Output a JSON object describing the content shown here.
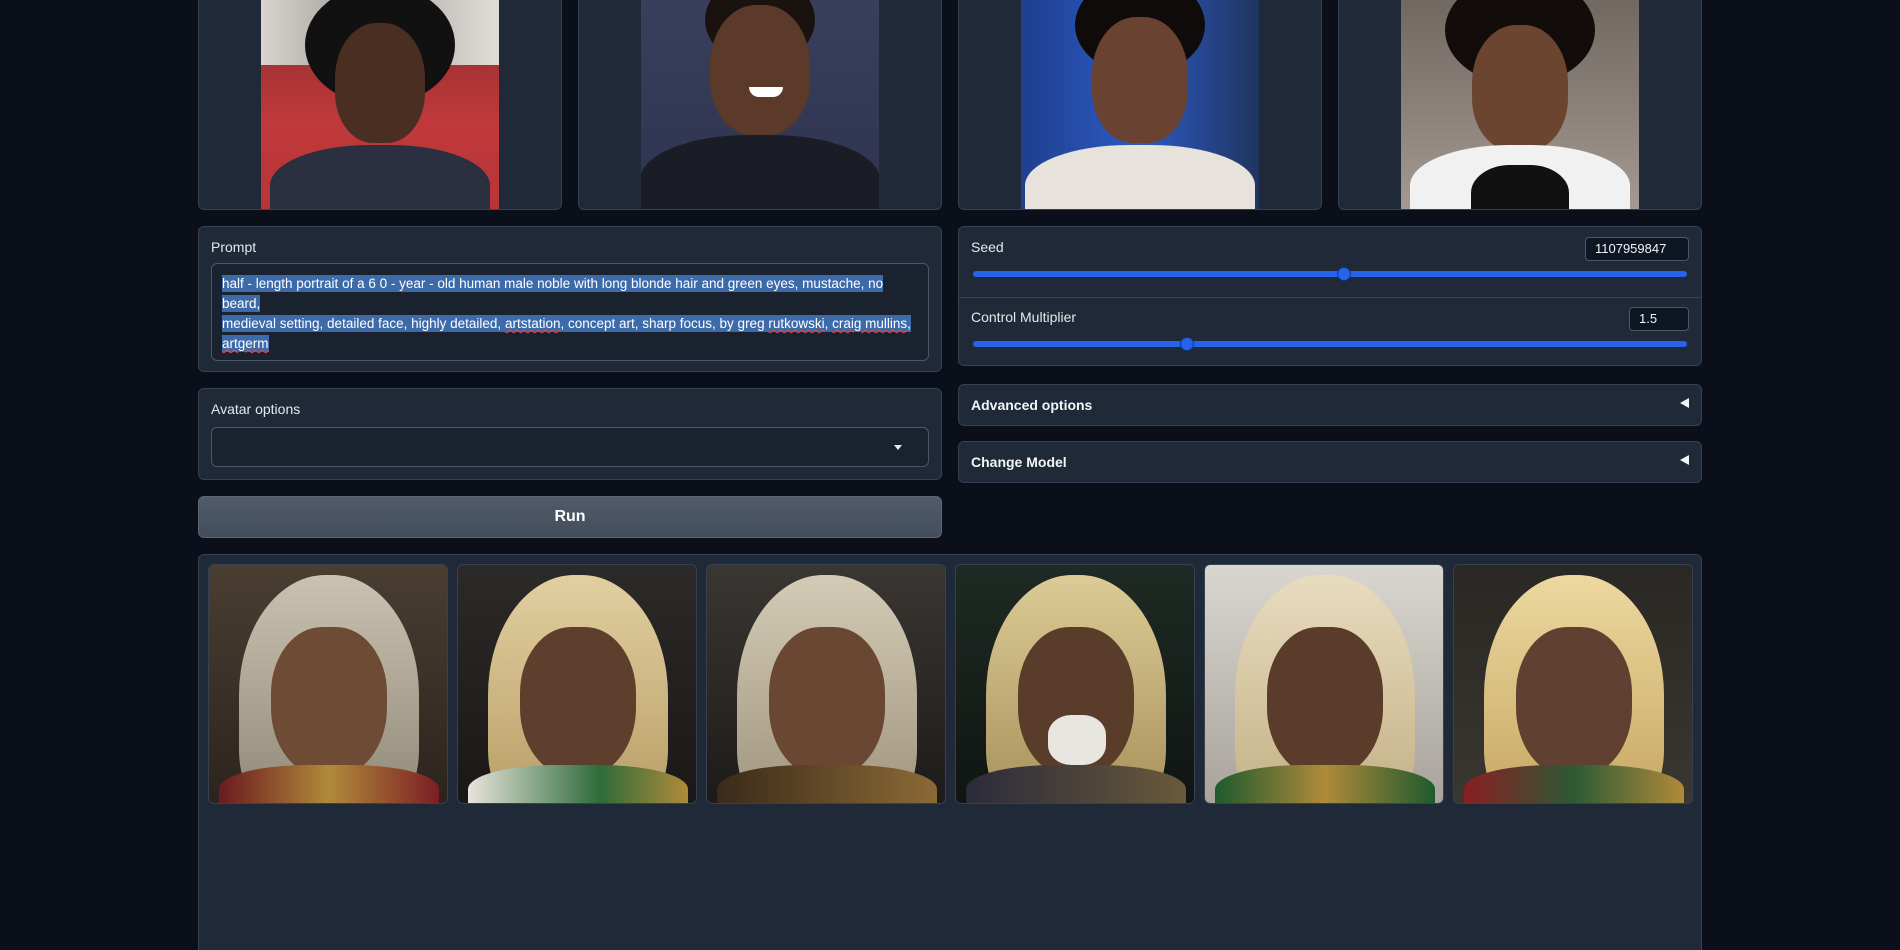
{
  "prompt": {
    "label": "Prompt",
    "value": "half - length portrait of a 6 0 - year - old human male noble with long blonde hair and green eyes, mustache, no beard, medieval setting, detailed face, highly detailed, artstation, concept art, sharp focus, by greg rutkowski, craig mullins, artgerm",
    "line1": "half - length portrait of a 6 0 - year - old human male noble with long blonde hair and green eyes, mustache, no beard,",
    "line2_a": "medieval setting, detailed face, highly detailed, ",
    "line2_b": "artstation",
    "line2_c": ", concept art, sharp focus, by greg ",
    "line2_d": "rutkowski",
    "line2_e": ", ",
    "line2_f": "craig mullins",
    "line2_g": ",",
    "line3": "artgerm"
  },
  "seed": {
    "label": "Seed",
    "value": "1107959847",
    "fraction": 0.52
  },
  "control_multiplier": {
    "label": "Control Multiplier",
    "value": "1.5",
    "fraction": 0.3
  },
  "avatar_options": {
    "label": "Avatar options",
    "selected": ""
  },
  "advanced_options": {
    "label": "Advanced options"
  },
  "change_model": {
    "label": "Change Model"
  },
  "run_button": {
    "label": "Run"
  },
  "input_photos": [
    "reference-photo-1",
    "reference-photo-2",
    "reference-photo-3",
    "reference-photo-4"
  ],
  "gallery": [
    "generated-portrait-1",
    "generated-portrait-2",
    "generated-portrait-3",
    "generated-portrait-4",
    "generated-portrait-5",
    "generated-portrait-6"
  ],
  "colors": {
    "accent": "#2563eb",
    "panel": "#1f2937",
    "background": "#0b0f19"
  }
}
